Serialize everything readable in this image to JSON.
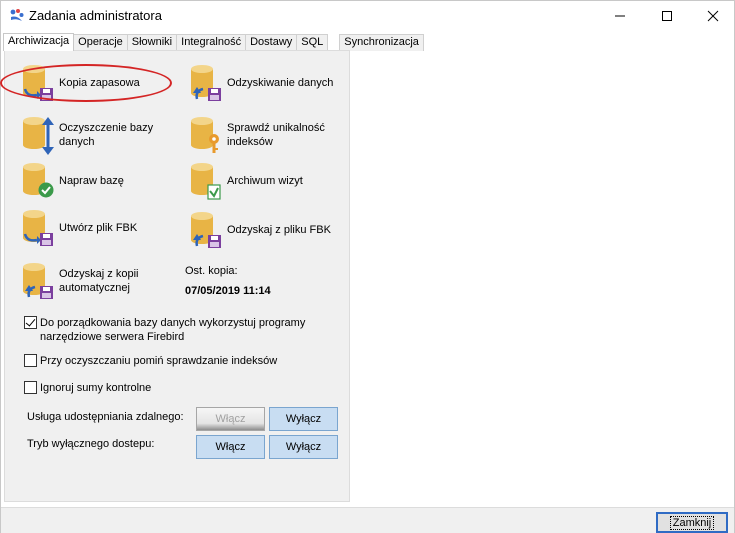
{
  "window": {
    "title": "Zadania administratora",
    "minimize": "—",
    "maximize": "☐",
    "close": "✕"
  },
  "tabs": [
    {
      "label": "Archiwizacja",
      "active": true
    },
    {
      "label": "Operacje"
    },
    {
      "label": "Słowniki"
    },
    {
      "label": "Integralność"
    },
    {
      "label": "Dostawy"
    },
    {
      "label": "SQL"
    },
    {
      "label": "Synchronizacja"
    }
  ],
  "actions": {
    "kopia": "Kopia zapasowa",
    "odzyskiwanie": "Odzyskiwanie danych",
    "oczyszczenie": "Oczyszczenie bazy danych",
    "unikalnosc": "Sprawdź unikalność indeksów",
    "napraw": "Napraw bazę",
    "archiwum": "Archiwum wizyt",
    "utworz_fbk": "Utwórz plik FBK",
    "odzyskaj_fbk": "Odzyskaj z pliku FBK",
    "odzyskaj_auto": "Odzyskaj z kopii automatycznej"
  },
  "last_backup": {
    "label": "Ost. kopia:",
    "value": "07/05/2019 11:14"
  },
  "options": {
    "firebird": {
      "label": "Do porządkowania bazy danych wykorzystuj programy narzędziowe serwera Firebird",
      "checked": true
    },
    "skip_index": {
      "label": "Przy oczyszczaniu pomiń sprawdzanie indeksów",
      "checked": false
    },
    "ignore_checksums": {
      "label": "Ignoruj sumy kontrolne",
      "checked": false
    }
  },
  "remote_sharing": {
    "label": "Usługa udostępniania zdalnego:",
    "on": "Włącz",
    "off": "Wyłącz"
  },
  "exclusive_access": {
    "label": "Tryb wyłącznego dostepu:",
    "on": "Włącz",
    "off": "Wyłącz"
  },
  "footer": {
    "close_label": "Zamknij"
  },
  "icons": {
    "db_color": "#e8b445",
    "db_top": "#f3d58a",
    "floppy": "#7b3f9e",
    "arrow": "#2f64b8",
    "check": "#3b9a4a",
    "key": "#e89a2c"
  },
  "annotation_color": "#d42525"
}
